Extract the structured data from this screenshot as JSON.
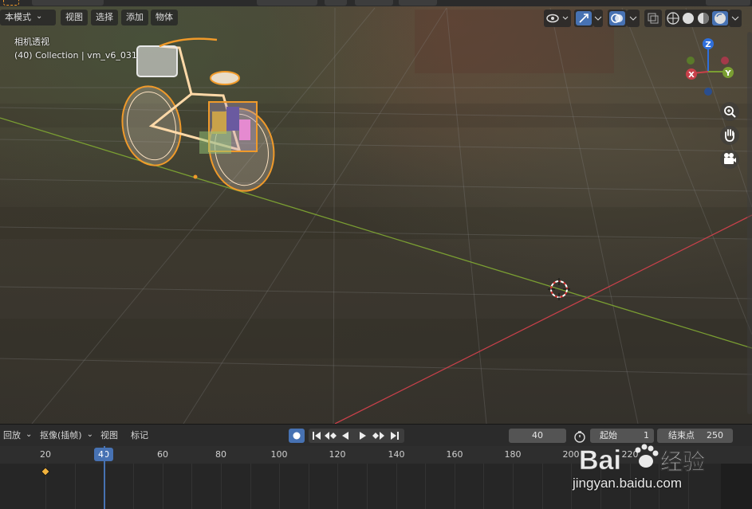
{
  "header": {
    "mode_label": "本模式",
    "menus": [
      "视图",
      "选择",
      "添加",
      "物体"
    ]
  },
  "viewport": {
    "view_name": "相机透视",
    "collection_info": "(40) Collection | vm_v6_031",
    "gizmo": {
      "z": "Z",
      "y": "Y",
      "x": "X"
    }
  },
  "timeline": {
    "playback_label": "回放",
    "keying_label": "抠像(插帧)",
    "view_label": "视图",
    "marker_label": "标记",
    "current_frame": "40",
    "start_label": "起始",
    "start_value": "1",
    "end_label": "结束点",
    "end_value": "250",
    "ruler_ticks": [
      "20",
      "40",
      "60",
      "80",
      "100",
      "120",
      "140",
      "160",
      "180",
      "200",
      "220"
    ],
    "cursor_frame": "40"
  },
  "watermark": {
    "logo_text": "Bai",
    "logo_text2": "经验",
    "url": "jingyan.baidu.com"
  },
  "colors": {
    "accent": "#4772b3",
    "x_axis": "#c8404a",
    "y_axis": "#7a9e32",
    "z_axis": "#2f6fdb",
    "selection": "#f09a2a",
    "keyframe": "#f2b33d"
  }
}
